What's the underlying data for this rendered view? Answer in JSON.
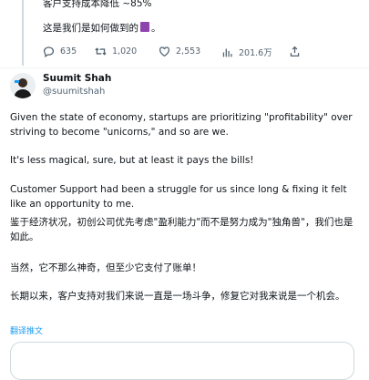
{
  "prev_tweet": {
    "line1": "客户支持成本降低 ~85%",
    "line2": "这是我们是如何做到的",
    "line2_end": "。",
    "actions": {
      "replies": "635",
      "retweets": "1,020",
      "likes": "2,553",
      "views": "201.6万"
    }
  },
  "tweet": {
    "author_name": "Suumit Shah",
    "author_handle": "@suumitshah",
    "paragraphs": [
      "Given the state of economy, startups are prioritizing \"profitability\" over striving to become \"unicorns,\" and so are we.",
      "It's less magical, sure, but at least it pays the bills!",
      "Customer Support had been a struggle for us since long & fixing it felt like an opportunity to me.",
      "鉴于经济状况，初创公司优先考虑\"盈利能力\"而不是努力成为\"独角兽\"，我们也是如此。",
      "当然，它不那么神奇，但至少它支付了账单！",
      "长期以来，客户支持对我们来说一直是一场斗争，修复它对我来说是一个机会。"
    ],
    "translate_label": "翻译推文"
  }
}
